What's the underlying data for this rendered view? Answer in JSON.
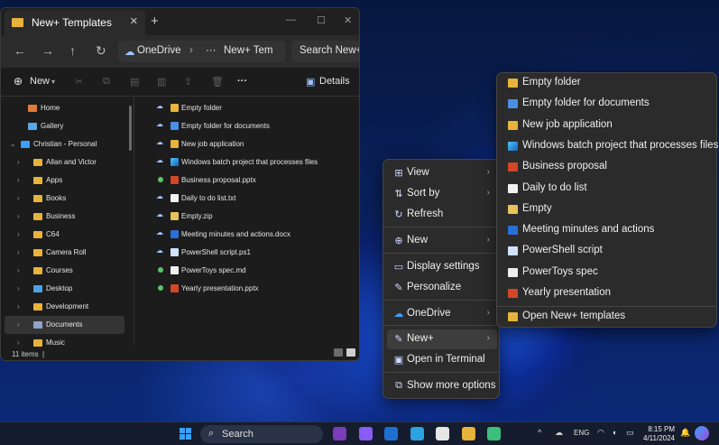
{
  "explorer": {
    "tab_title": "New+ Templates",
    "tab_close": "✕",
    "new_tab": "+",
    "window_controls": [
      "—",
      "☐",
      "✕"
    ],
    "nav": {
      "back": "←",
      "forward": "→",
      "up": "↑",
      "refresh": "↻"
    },
    "path": {
      "root": "OneDrive",
      "separator": "›",
      "ellipsis": "···",
      "current": "New+ Tem"
    },
    "search_placeholder": "Search New+",
    "toolbar": {
      "new_label": "New",
      "more": "···",
      "details_label": "Details"
    },
    "sidebar": [
      {
        "label": "Home",
        "icon": "home-icon",
        "expandable": false
      },
      {
        "label": "Gallery",
        "icon": "gallery-icon",
        "expandable": false
      },
      {
        "label": "Christian - Personal",
        "icon": "onedrive-icon",
        "expandable": true,
        "expanded": true
      },
      {
        "label": "Allan and Victor",
        "icon": "folder-icon",
        "expandable": true
      },
      {
        "label": "Apps",
        "icon": "folder-icon",
        "expandable": true
      },
      {
        "label": "Books",
        "icon": "folder-icon",
        "expandable": true
      },
      {
        "label": "Business",
        "icon": "folder-icon",
        "expandable": true
      },
      {
        "label": "C64",
        "icon": "folder-icon",
        "expandable": true
      },
      {
        "label": "Camera Roll",
        "icon": "folder-icon",
        "expandable": true
      },
      {
        "label": "Courses",
        "icon": "folder-icon",
        "expandable": true
      },
      {
        "label": "Desktop",
        "icon": "desktop-folder-icon",
        "expandable": true
      },
      {
        "label": "Development",
        "icon": "folder-icon",
        "expandable": true
      },
      {
        "label": "Documents",
        "icon": "documents-folder-icon",
        "expandable": true,
        "selected": true
      },
      {
        "label": "Music",
        "icon": "folder-icon",
        "expandable": true
      }
    ],
    "files": [
      {
        "name": "Empty folder",
        "icon": "folder",
        "sync": "cloud"
      },
      {
        "name": "Empty folder for documents",
        "icon": "docblue",
        "sync": "cloud"
      },
      {
        "name": "New job application",
        "icon": "folder",
        "sync": "cloud"
      },
      {
        "name": "Windows batch project that processes files",
        "icon": "winimg",
        "sync": "cloud"
      },
      {
        "name": "Business proposal.pptx",
        "icon": "pptx",
        "sync": "synced"
      },
      {
        "name": "Daily to do list.txt",
        "icon": "txtdoc",
        "sync": "cloud"
      },
      {
        "name": "Empty.zip",
        "icon": "zipf",
        "sync": "cloud"
      },
      {
        "name": "Meeting minutes and actions.docx",
        "icon": "docx",
        "sync": "cloud"
      },
      {
        "name": "PowerShell script.ps1",
        "icon": "ps1",
        "sync": "cloud"
      },
      {
        "name": "PowerToys spec.md",
        "icon": "mdf",
        "sync": "synced"
      },
      {
        "name": "Yearly presentation.pptx",
        "icon": "pptx",
        "sync": "synced"
      }
    ],
    "status": {
      "item_count": "11 items",
      "separator": "|"
    }
  },
  "context_menu": {
    "items": [
      {
        "label": "View",
        "icon": "view-grid-icon",
        "glyph": "⊞",
        "submenu": true
      },
      {
        "label": "Sort by",
        "icon": "sort-icon",
        "glyph": "⇅",
        "submenu": true
      },
      {
        "label": "Refresh",
        "icon": "refresh-icon",
        "glyph": "↻",
        "submenu": false
      },
      {
        "label": "New",
        "icon": "new-icon",
        "glyph": "⊕",
        "submenu": true
      },
      {
        "label": "Display settings",
        "icon": "display-icon",
        "glyph": "▭",
        "submenu": false
      },
      {
        "label": "Personalize",
        "icon": "personalize-icon",
        "glyph": "✎",
        "submenu": false
      },
      {
        "label": "OneDrive",
        "icon": "onedrive-icon",
        "glyph": "☁",
        "submenu": true
      },
      {
        "label": "New+",
        "icon": "new-plus-icon",
        "glyph": "✎",
        "submenu": true,
        "active": true
      },
      {
        "label": "Open in Terminal",
        "icon": "terminal-icon",
        "glyph": "▣",
        "submenu": false
      },
      {
        "label": "Show more options",
        "icon": "more-options-icon",
        "glyph": "⧉",
        "submenu": false
      }
    ],
    "submenu_chevron": "›"
  },
  "submenu": {
    "items": [
      {
        "label": "Empty folder",
        "icon": "folder"
      },
      {
        "label": "Empty folder for documents",
        "icon": "docblue"
      },
      {
        "label": "New job application",
        "icon": "folder"
      },
      {
        "label": "Windows batch project that processes files",
        "icon": "winimg"
      },
      {
        "label": "Business proposal",
        "icon": "pptx"
      },
      {
        "label": "Daily to do list",
        "icon": "txtdoc"
      },
      {
        "label": "Empty",
        "icon": "zipf"
      },
      {
        "label": "Meeting minutes and actions",
        "icon": "docx"
      },
      {
        "label": "PowerShell script",
        "icon": "ps1"
      },
      {
        "label": "PowerToys spec",
        "icon": "mdf"
      },
      {
        "label": "Yearly presentation",
        "icon": "pptx"
      }
    ],
    "open_templates_label": "Open New+ templates"
  },
  "taskbar": {
    "search_label": "Search",
    "search_glyph": "⌕",
    "apps": [
      "onenote-app",
      "visual-studio-app",
      "outlook-app",
      "edge-app",
      "github-app",
      "file-explorer-app",
      "edge-dev-app"
    ],
    "app_colors": [
      "#7a3db8",
      "#8a5cf6",
      "#1f6fd1",
      "#2ba3e0",
      "#e6e6e6",
      "#e8b33b",
      "#3cbf7a"
    ],
    "tray": {
      "chevron": "^",
      "language": "ENG",
      "time": "8:15 PM",
      "date": "4/11/2024"
    }
  },
  "colors": {
    "accent": "#3aa0ff",
    "folder": "#e8b33b",
    "menu_bg": "#2b2b2b",
    "explorer_bg": "#1c1c1c"
  }
}
